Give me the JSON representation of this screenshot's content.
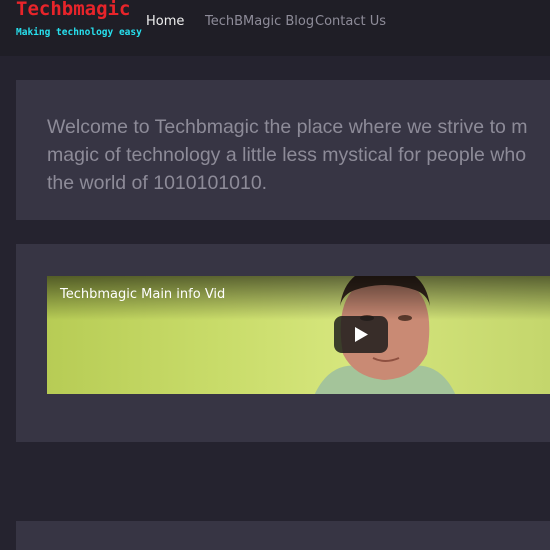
{
  "brand": {
    "name": "Techbmagic",
    "tagline": "Making technology easy"
  },
  "nav": {
    "items": [
      {
        "label": "Home",
        "active": true
      },
      {
        "label": "TechBMagic Blog",
        "active": false
      },
      {
        "label": "Contact Us",
        "active": false
      }
    ]
  },
  "welcome": {
    "lines": [
      "Welcome to Techbmagic the place where we strive to m",
      "magic of technology a little less mystical for people who",
      "the world of 1010101010."
    ]
  },
  "video": {
    "title": "Techbmagic Main info Vid",
    "play_icon": "play-icon"
  },
  "colors": {
    "page_bg": "#25232f",
    "navbar_bg": "#1f1e26",
    "card_bg": "#373544",
    "brand": "#e8242a",
    "tagline": "#27e0ee",
    "welcome_text": "#8d8b98"
  }
}
